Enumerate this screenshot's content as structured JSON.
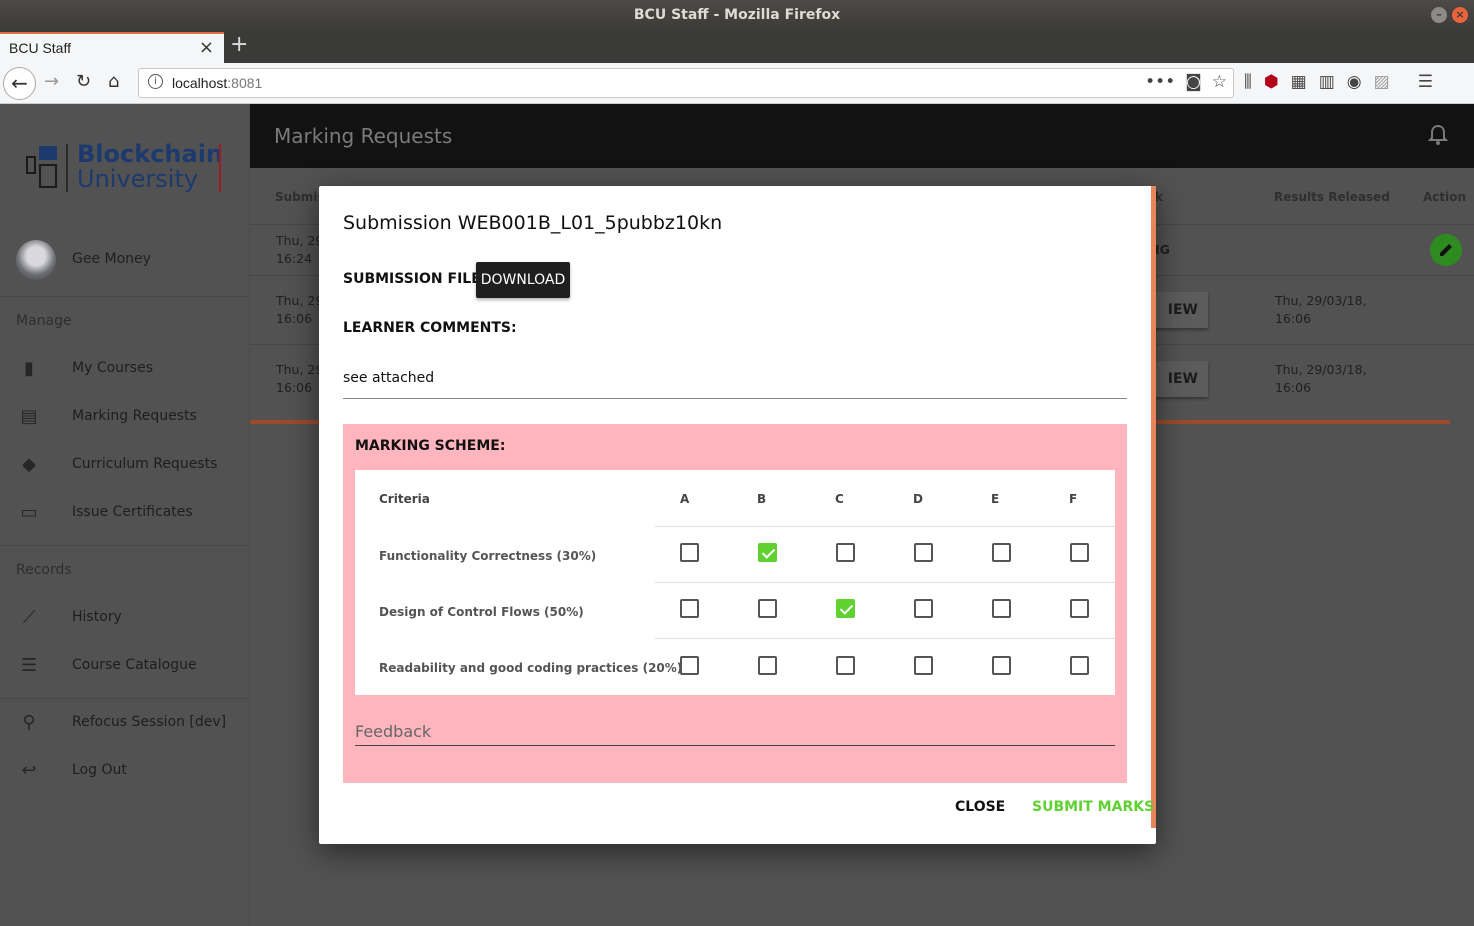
{
  "window": {
    "title": "BCU Staff - Mozilla Firefox"
  },
  "browser": {
    "tab_title": "BCU Staff",
    "url_host": "localhost",
    "url_port": ":8081"
  },
  "sidebar": {
    "logo": {
      "line1": "Blockchain",
      "line2": "University"
    },
    "user_name": "Gee Money",
    "manage_label": "Manage",
    "manage_items": [
      {
        "label": "My Courses",
        "icon": "book-icon"
      },
      {
        "label": "Marking Requests",
        "icon": "clipboard-icon"
      },
      {
        "label": "Curriculum Requests",
        "icon": "school-icon"
      },
      {
        "label": "Issue Certificates",
        "icon": "certificate-icon"
      }
    ],
    "records_label": "Records",
    "records_items": [
      {
        "label": "History",
        "icon": "trend-icon"
      },
      {
        "label": "Course Catalogue",
        "icon": "list-icon"
      }
    ],
    "bottom_items": [
      {
        "label": "Refocus Session [dev]",
        "icon": "walk-icon"
      },
      {
        "label": "Log Out",
        "icon": "reply-icon"
      }
    ]
  },
  "appbar": {
    "title": "Marking Requests"
  },
  "table": {
    "headers": {
      "submission": "Submiss",
      "mark": "k",
      "results_released": "Results Released",
      "action": "Action"
    },
    "rows": [
      {
        "submitted_1": "Thu, 29",
        "submitted_2": "16:24",
        "mark": "IG",
        "released_1": "",
        "released_2": "",
        "action": "edit"
      },
      {
        "submitted_1": "Thu, 29",
        "submitted_2": "16:06",
        "mark": "IEW",
        "released_1": "Thu, 29/03/18,",
        "released_2": "16:06",
        "action": "view"
      },
      {
        "submitted_1": "Thu, 29",
        "submitted_2": "16:06",
        "mark": "IEW",
        "released_1": "Thu, 29/03/18,",
        "released_2": "16:06",
        "action": "view"
      }
    ]
  },
  "modal": {
    "title": "Submission WEB001B_L01_5pubbz10kn",
    "submission_file_label": "SUBMISSION FILE:",
    "download_label": "DOWNLOAD",
    "learner_comments_label": "LEARNER COMMENTS:",
    "learner_comments_value": "see attached",
    "marking_scheme_label": "MARKING SCHEME:",
    "criteria_header": "Criteria",
    "grades": [
      "A",
      "B",
      "C",
      "D",
      "E",
      "F"
    ],
    "criteria": [
      {
        "name": "Functionality Correctness (30%)",
        "selected": "B"
      },
      {
        "name": "Design of Control Flows (50%)",
        "selected": "C"
      },
      {
        "name": "Readability and good coding practices (20%)",
        "selected": null
      }
    ],
    "feedback_placeholder": "Feedback",
    "close_label": "CLOSE",
    "submit_label": "SUBMIT MARKS",
    "accent_color": "#5fd130",
    "scheme_bg_color": "#ffb5be"
  }
}
